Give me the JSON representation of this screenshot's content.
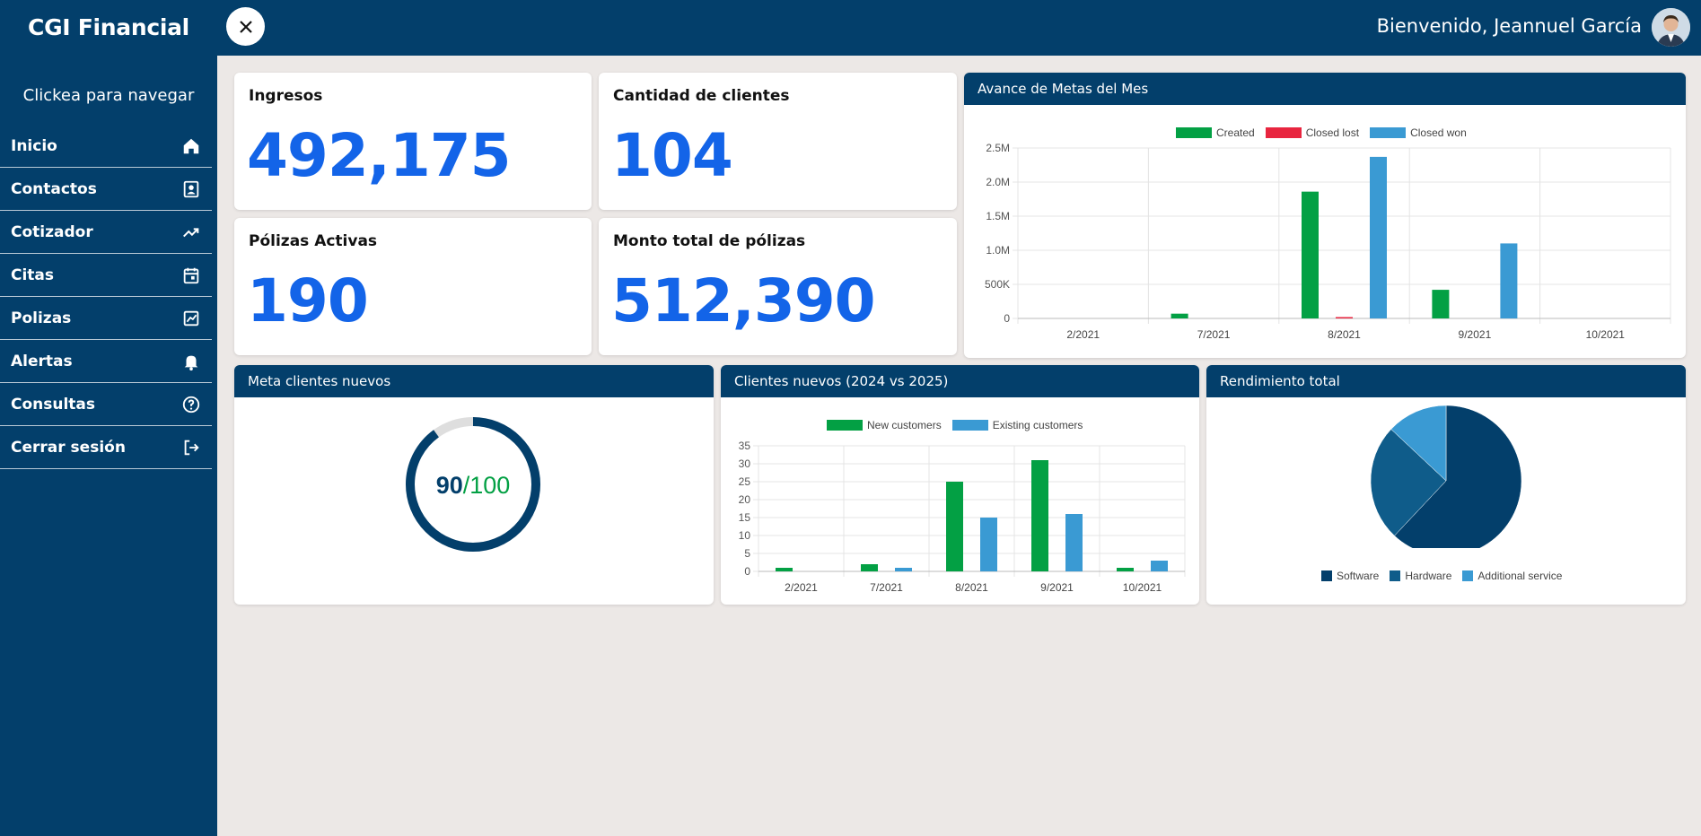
{
  "sidebar": {
    "brand": "CGI Financial",
    "hint": "Clickea para navegar",
    "items": [
      {
        "label": "Inicio",
        "icon": "home-icon"
      },
      {
        "label": "Contactos",
        "icon": "contacts-icon"
      },
      {
        "label": "Cotizador",
        "icon": "trending-up-icon"
      },
      {
        "label": "Citas",
        "icon": "calendar-icon"
      },
      {
        "label": "Polizas",
        "icon": "chart-icon"
      },
      {
        "label": "Alertas",
        "icon": "bell-icon"
      },
      {
        "label": "Consultas",
        "icon": "help-icon"
      },
      {
        "label": "Cerrar sesión",
        "icon": "logout-icon"
      }
    ]
  },
  "header": {
    "welcome": "Bienvenido, Jeannuel García"
  },
  "stats": {
    "ingresos": {
      "label": "Ingresos",
      "value": "492,175"
    },
    "clientes": {
      "label": "Cantidad de clientes",
      "value": "104"
    },
    "polizas": {
      "label": "Pólizas Activas",
      "value": "190"
    },
    "monto": {
      "label": "Monto total de pólizas",
      "value": "512,390"
    }
  },
  "colors": {
    "navy": "#033f6b",
    "blue_text": "#1364e8",
    "green": "#03a044",
    "red": "#e8253f",
    "light_blue": "#3a9ad3",
    "mid_blue": "#0f5c8a"
  },
  "chart_data": [
    {
      "type": "bar",
      "title": "Avance de Metas del Mes",
      "categories": [
        "2/2021",
        "7/2021",
        "8/2021",
        "9/2021",
        "10/2021"
      ],
      "series": [
        {
          "name": "Created",
          "values": [
            0,
            70000,
            1860000,
            420000,
            0
          ]
        },
        {
          "name": "Closed lost",
          "values": [
            0,
            0,
            20000,
            0,
            0
          ]
        },
        {
          "name": "Closed won",
          "values": [
            0,
            0,
            2370000,
            1100000,
            0
          ]
        }
      ],
      "ylim": [
        0,
        2500000
      ],
      "yticks": [
        "2.5M",
        "2.0M",
        "1.5M",
        "1.0M",
        "500K",
        "0"
      ],
      "legend": "top",
      "grid": true
    },
    {
      "type": "donut",
      "title": "Meta clientes nuevos",
      "value": 90,
      "total": 100,
      "value_label": "90",
      "total_label": "/100"
    },
    {
      "type": "bar",
      "title": "Clientes nuevos (2024 vs 2025)",
      "categories": [
        "2/2021",
        "7/2021",
        "8/2021",
        "9/2021",
        "10/2021"
      ],
      "series": [
        {
          "name": "New customers",
          "values": [
            1,
            2,
            25,
            31,
            1
          ]
        },
        {
          "name": "Existing customers",
          "values": [
            0,
            1,
            15,
            16,
            3
          ]
        }
      ],
      "ylim": [
        0,
        35
      ],
      "yticks": [
        "35",
        "30",
        "25",
        "20",
        "15",
        "10",
        "5",
        "0"
      ],
      "legend": "top",
      "grid": true
    },
    {
      "type": "pie",
      "title": "Rendimiento total",
      "slices": [
        {
          "name": "Software",
          "value": 62
        },
        {
          "name": "Hardware",
          "value": 25
        },
        {
          "name": "Additional service",
          "value": 13
        }
      ],
      "legend": "bottom"
    }
  ]
}
